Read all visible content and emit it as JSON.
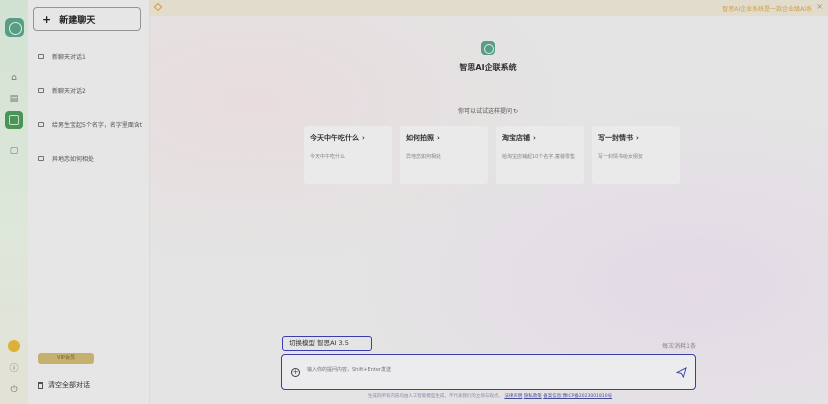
{
  "sidebar": {
    "new_chat_label": "新建聊天",
    "chats": [
      {
        "label": "新聊天对话1"
      },
      {
        "label": "新聊天对话2"
      },
      {
        "label": "给男生宝起5个名字，名字里面含t"
      },
      {
        "label": "异地恋如何相处"
      }
    ],
    "vip_label": "VIP会员",
    "clear_label": "清空全部对话"
  },
  "topbar": {
    "notice": "智思AI企业系统是一款企业级AI系",
    "close_glyph": "×"
  },
  "brand": {
    "name": "智思AI企联系统"
  },
  "hint": {
    "text": "你可以试试这样提问",
    "refresh_glyph": "↻"
  },
  "cards": [
    {
      "title": "今天中午吃什么",
      "desc": "今天中午吃什么"
    },
    {
      "title": "如何拍照",
      "desc": "异地恋如何相处"
    },
    {
      "title": "淘宝店铺",
      "desc": "给淘宝店铺起10个名字,童装零售"
    },
    {
      "title": "写一封情书",
      "desc": "写一封情书给女朋友"
    }
  ],
  "card_arrow": "›",
  "composer": {
    "model_label": "切换模型 智思AI 3.5",
    "daily_usage": "每次消耗1条",
    "placeholder": "输入你的提问内容，Shift+Enter发送",
    "footer_text": "生成的所有内容均由人工智能模型生成，不代表我们的立场与观点。",
    "footer_links": [
      "法律声明",
      "隐私政策",
      "备案信息:豫ICP备2023001810号"
    ]
  },
  "colors": {
    "accent": "#3d3fb0",
    "brand_green": "#5aa48a",
    "notice": "#d9a341",
    "vip": "#cdb673"
  }
}
